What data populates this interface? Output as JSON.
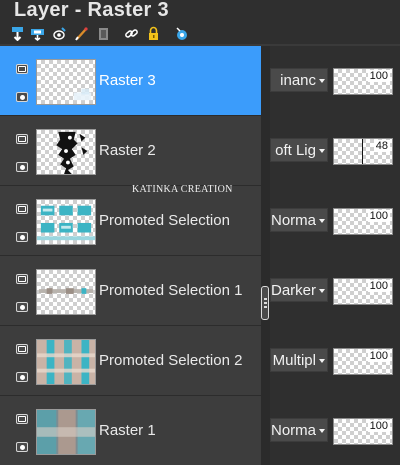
{
  "panel": {
    "title": "Layer - Raster 3"
  },
  "toolbar": {
    "icons": [
      "new-layer-icon",
      "new-mask-icon",
      "link-icon-1",
      "paint-icon",
      "delete-layer-icon",
      "link-icon-2",
      "lock-icon",
      "visibility-icon"
    ]
  },
  "watermark": "KATINKA CREATION",
  "colors": {
    "selected_row": "#3b9cfb",
    "row_bg": "#3d3d3d",
    "panel_bg": "#2f2f2f",
    "teal_accent": "#3cb4c4"
  },
  "layers": [
    {
      "name": "Raster 3",
      "selected": true,
      "blend_mode": "Luminance",
      "blend_display": "inanc",
      "opacity": "100",
      "opacity_fraction": 1.0
    },
    {
      "name": "Raster 2",
      "selected": false,
      "blend_mode": "Soft Light",
      "blend_display": "oft Lig",
      "opacity": "48",
      "opacity_fraction": 0.48
    },
    {
      "name": "Promoted Selection",
      "selected": false,
      "blend_mode": "Normal",
      "blend_display": "Norma",
      "opacity": "100",
      "opacity_fraction": 1.0
    },
    {
      "name": "Promoted Selection 1",
      "selected": false,
      "blend_mode": "Darken",
      "blend_display": "Darker",
      "opacity": "100",
      "opacity_fraction": 1.0
    },
    {
      "name": "Promoted Selection 2",
      "selected": false,
      "blend_mode": "Multiply",
      "blend_display": "Multipl",
      "opacity": "100",
      "opacity_fraction": 1.0
    },
    {
      "name": "Raster 1",
      "selected": false,
      "blend_mode": "Normal",
      "blend_display": "Norma",
      "opacity": "100",
      "opacity_fraction": 1.0
    }
  ]
}
